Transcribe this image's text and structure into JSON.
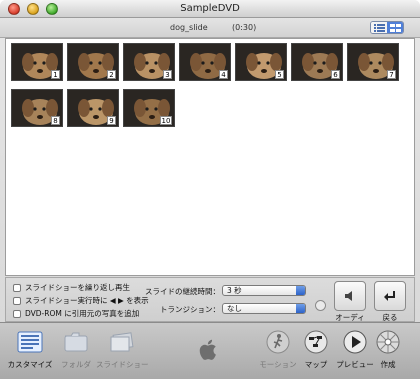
{
  "window": {
    "title": "SampleDVD"
  },
  "header": {
    "slideshow_name": "dog_slide",
    "duration": "(0:30)"
  },
  "slides": [
    {
      "number": "1",
      "tint": "#b0875a"
    },
    {
      "number": "2",
      "tint": "#a1784c"
    },
    {
      "number": "3",
      "tint": "#b99265"
    },
    {
      "number": "4",
      "tint": "#8f6a44"
    },
    {
      "number": "5",
      "tint": "#c29a6e"
    },
    {
      "number": "6",
      "tint": "#9d7a54"
    },
    {
      "number": "7",
      "tint": "#ad8a5f"
    },
    {
      "number": "8",
      "tint": "#a7835a"
    },
    {
      "number": "9",
      "tint": "#bb9668"
    },
    {
      "number": "10",
      "tint": "#946f47"
    }
  ],
  "settings": {
    "checkboxes": [
      "スライドショーを繰り返し再生",
      "スライドショー実行時に ◀ ▶ を表示",
      "DVD-ROM に引用元の写真を追加"
    ],
    "duration_label": "スライドの継続時間：",
    "duration_value": "3 秒",
    "transition_label": "トランジション：",
    "transition_value": "なし",
    "audio_label": "オーディオ",
    "back_label": "戻る"
  },
  "toolbar": {
    "customize": "カスタマイズ",
    "folder": "フォルダ",
    "slideshow": "スライドショー",
    "motion": "モーション",
    "map": "マップ",
    "preview": "プレビュー",
    "burn": "作成"
  },
  "colors": {
    "accent": "#2d63c9",
    "selected_view": "#4f7fd8"
  }
}
